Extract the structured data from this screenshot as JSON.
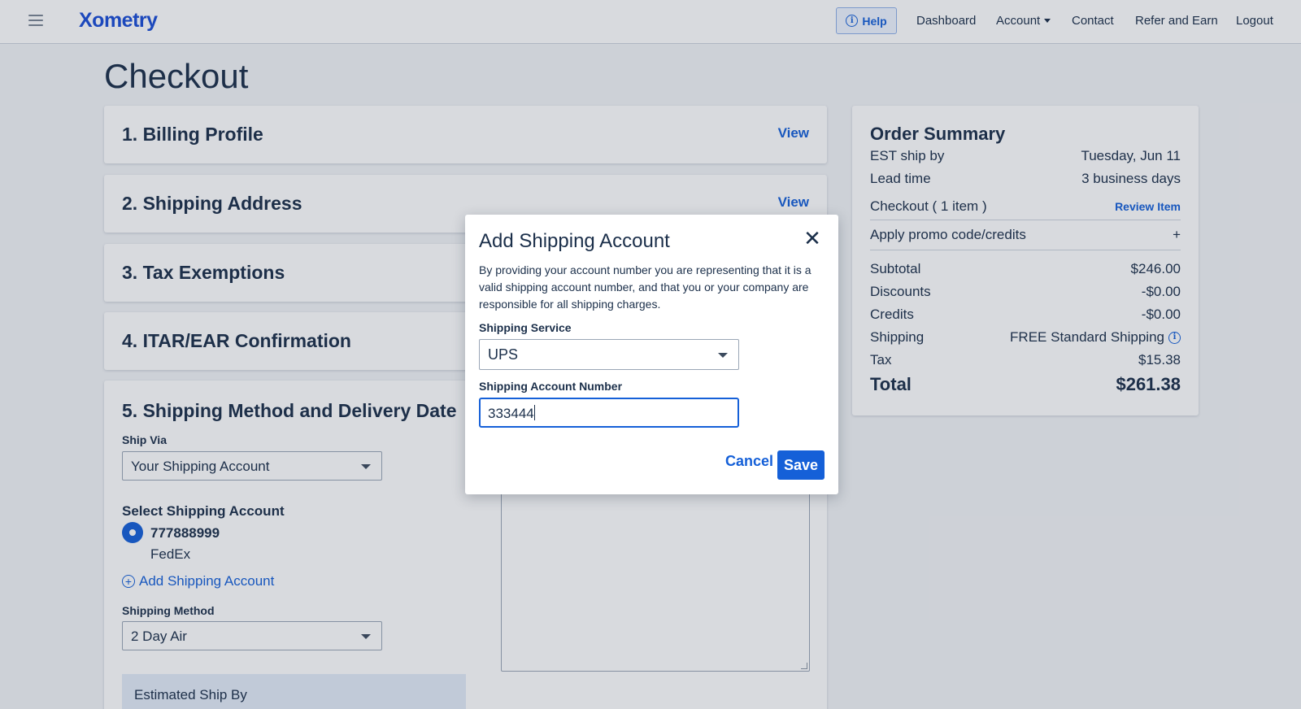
{
  "nav": {
    "logo": "Xometry",
    "help_label": "Help",
    "dashboard": "Dashboard",
    "account": "Account",
    "contact": "Contact",
    "refer": "Refer and Earn",
    "logout": "Logout"
  },
  "page": {
    "title": "Checkout"
  },
  "steps": {
    "billing": {
      "title": "1. Billing Profile",
      "action": "View"
    },
    "shipping_address": {
      "title": "2. Shipping Address",
      "action": "View"
    },
    "tax": {
      "title": "3. Tax Exemptions"
    },
    "itar": {
      "title": "4. ITAR/EAR Confirmation"
    },
    "shipping_method": {
      "title": "5. Shipping Method and Delivery Date",
      "ship_via_label": "Ship Via",
      "ship_via_value": "Your Shipping Account",
      "select_account_label": "Select Shipping Account",
      "account_number": "777888999",
      "account_carrier": "FedEx",
      "add_account": "Add Shipping Account",
      "method_label": "Shipping Method",
      "method_value": "2 Day Air",
      "est_ship_label": "Estimated Ship By"
    }
  },
  "summary": {
    "title": "Order Summary",
    "est_ship_label": "EST ship by",
    "est_ship_value": "Tuesday, Jun 11",
    "lead_label": "Lead time",
    "lead_value": "3 business days",
    "checkout_label": "Checkout ( 1 item )",
    "review_item": "Review Item",
    "promo_label": "Apply promo code/credits",
    "promo_action": "+",
    "subtotal_label": "Subtotal",
    "subtotal_value": "$246.00",
    "discounts_label": "Discounts",
    "discounts_value": "-$0.00",
    "credits_label": "Credits",
    "credits_value": "-$0.00",
    "shipping_label": "Shipping",
    "shipping_value": "FREE Standard Shipping",
    "tax_label": "Tax",
    "tax_value": "$15.38",
    "total_label": "Total",
    "total_value": "$261.38"
  },
  "modal": {
    "title": "Add Shipping Account",
    "description": "By providing your account number you are representing that it is a valid shipping account number, and that you or your company are responsible for all shipping charges.",
    "service_label": "Shipping Service",
    "service_value": "UPS",
    "account_label": "Shipping Account Number",
    "account_value": "333444",
    "cancel": "Cancel",
    "save": "Save"
  },
  "colors": {
    "accent": "#1560d8",
    "text": "#1b2f4a",
    "background": "#f2f4f7"
  }
}
